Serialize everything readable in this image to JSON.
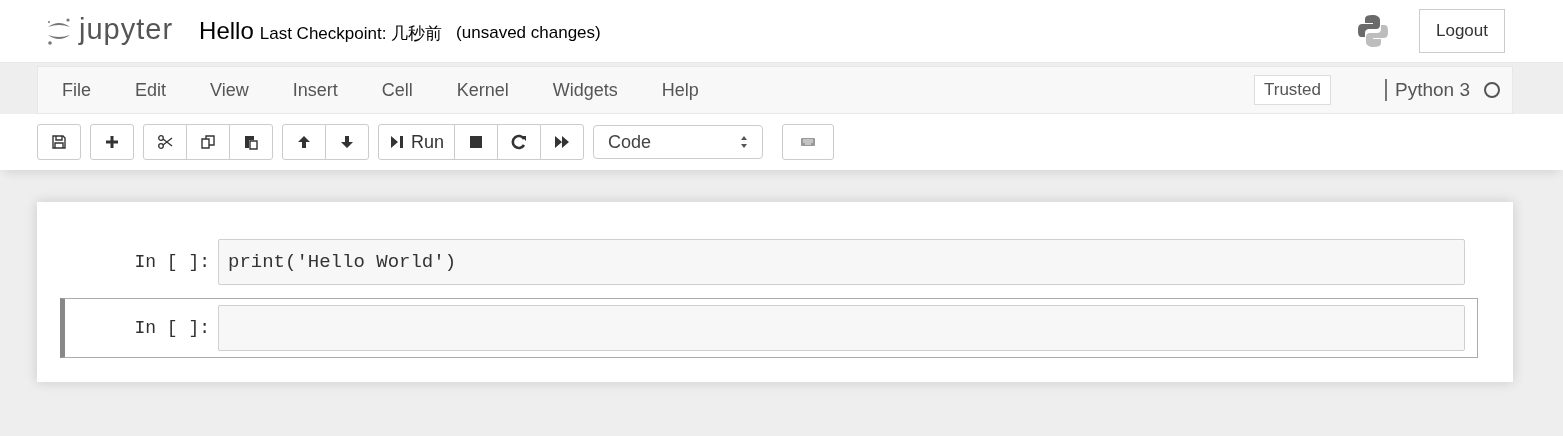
{
  "header": {
    "logo": "jupyter",
    "notebook_name": "Hello",
    "checkpoint": "Last Checkpoint: 几秒前",
    "autosave_status": "(unsaved changes)",
    "logout": "Logout"
  },
  "menu": [
    "File",
    "Edit",
    "View",
    "Insert",
    "Cell",
    "Kernel",
    "Widgets",
    "Help"
  ],
  "trusted": "Trusted",
  "kernel": {
    "name": "Python 3",
    "busy": false
  },
  "toolbar": {
    "groups": [
      [
        {
          "kind": "save"
        }
      ],
      [
        {
          "kind": "plus"
        }
      ],
      [
        {
          "kind": "cut"
        },
        {
          "kind": "copy"
        },
        {
          "kind": "paste"
        }
      ],
      [
        {
          "kind": "up"
        },
        {
          "kind": "down"
        }
      ],
      [
        {
          "kind": "run",
          "label": "Run"
        },
        {
          "kind": "stop"
        },
        {
          "kind": "restart"
        },
        {
          "kind": "fastforward"
        }
      ]
    ],
    "cell_type": "Code",
    "extra": [
      {
        "kind": "keyboard"
      }
    ]
  },
  "cells": [
    {
      "prompt": "In [ ]:",
      "code": "print('Hello World')",
      "selected": false
    },
    {
      "prompt": "In [ ]:",
      "selected": true
    }
  ]
}
